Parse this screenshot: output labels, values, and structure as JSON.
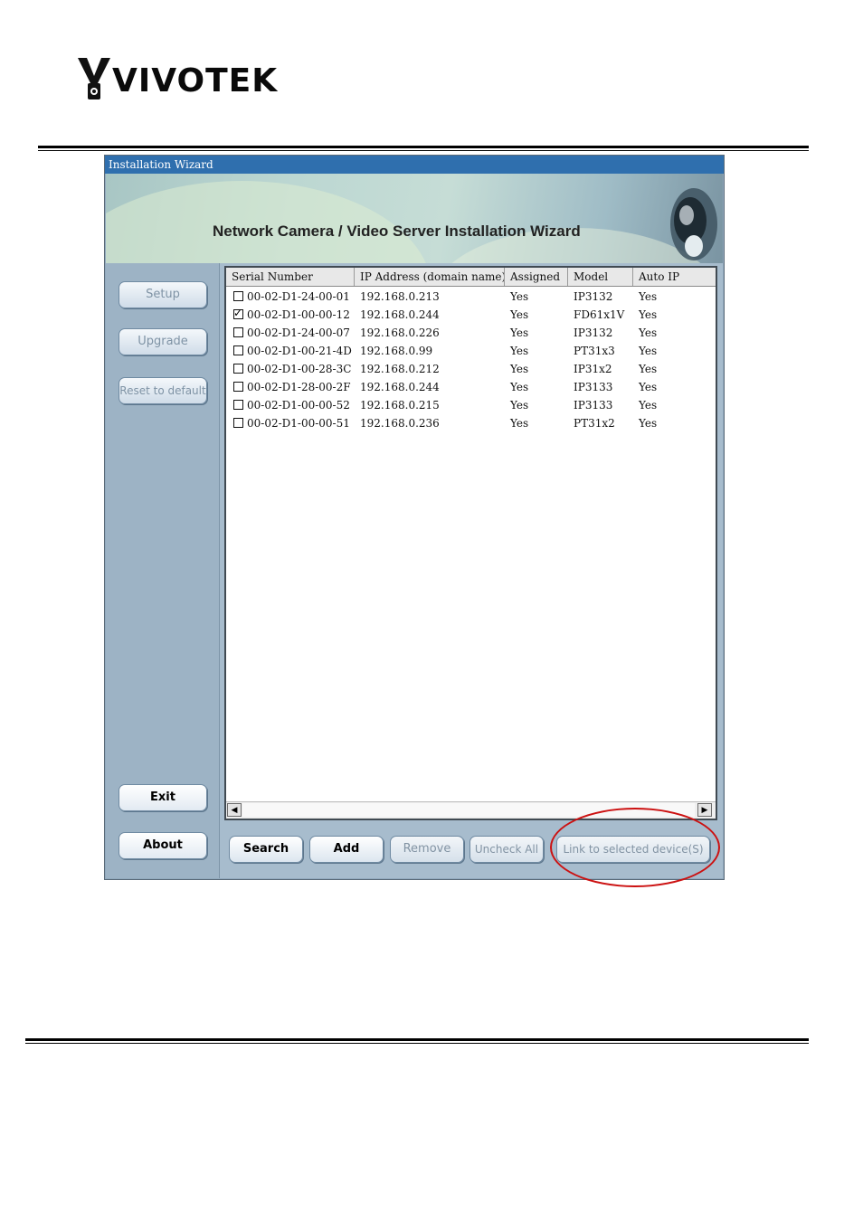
{
  "logo": {
    "text": "VIVOTEK",
    "mark_icon": "vivotek-camera-logo-icon"
  },
  "window": {
    "title": "Installation Wizard",
    "banner_title": "Network Camera / Video Server Installation Wizard",
    "banner_icon": "camera-lens-icon"
  },
  "sidebar": {
    "setup": "Setup",
    "upgrade": "Upgrade",
    "reset": "Reset to default",
    "exit": "Exit",
    "about": "About"
  },
  "table": {
    "columns": [
      "Serial Number",
      "IP Address (domain name)",
      "Assigned",
      "Model",
      "Auto IP"
    ],
    "rows": [
      {
        "checked": false,
        "serial": "00-02-D1-24-00-01",
        "ip": "192.168.0.213",
        "assigned": "Yes",
        "model": "IP3132",
        "auto_ip": "Yes"
      },
      {
        "checked": true,
        "serial": "00-02-D1-00-00-12",
        "ip": "192.168.0.244",
        "assigned": "Yes",
        "model": "FD61x1V",
        "auto_ip": "Yes"
      },
      {
        "checked": false,
        "serial": "00-02-D1-24-00-07",
        "ip": "192.168.0.226",
        "assigned": "Yes",
        "model": "IP3132",
        "auto_ip": "Yes"
      },
      {
        "checked": false,
        "serial": "00-02-D1-00-21-4D",
        "ip": "192.168.0.99",
        "assigned": "Yes",
        "model": "PT31x3",
        "auto_ip": "Yes"
      },
      {
        "checked": false,
        "serial": "00-02-D1-00-28-3C",
        "ip": "192.168.0.212",
        "assigned": "Yes",
        "model": "IP31x2",
        "auto_ip": "Yes"
      },
      {
        "checked": false,
        "serial": "00-02-D1-28-00-2F",
        "ip": "192.168.0.244",
        "assigned": "Yes",
        "model": "IP3133",
        "auto_ip": "Yes"
      },
      {
        "checked": false,
        "serial": "00-02-D1-00-00-52",
        "ip": "192.168.0.215",
        "assigned": "Yes",
        "model": "IP3133",
        "auto_ip": "Yes"
      },
      {
        "checked": false,
        "serial": "00-02-D1-00-00-51",
        "ip": "192.168.0.236",
        "assigned": "Yes",
        "model": "PT31x2",
        "auto_ip": "Yes"
      }
    ]
  },
  "buttons": {
    "search": "Search",
    "add": "Add",
    "remove": "Remove",
    "uncheck_all": "Uncheck All",
    "link": "Link to selected device(S)"
  },
  "colors": {
    "titlebar": "#2f6fae",
    "callout": "#cc1111",
    "panel": "#92aabe"
  }
}
